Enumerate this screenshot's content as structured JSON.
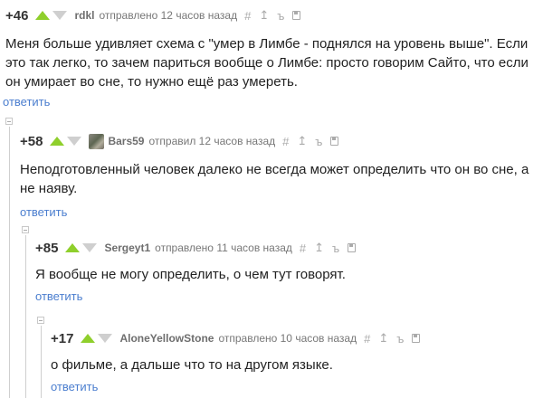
{
  "comments": [
    {
      "rating": "+46",
      "user": "rdkl",
      "meta": "отправлено 12 часов назад",
      "text": "Меня больше удивляет схема с \"умер в Лимбе - поднялся на уровень выше\". Если это так легко, то зачем париться вообще о Лимбе: просто говорим Сайто, что если он умирает во сне, то нужно ещё раз умереть.",
      "reply": "ответить"
    },
    {
      "rating": "+58",
      "user": "Bars59",
      "meta": "отправил 12 часов назад",
      "text": "Неподготовленный человек далеко не всегда может определить что он во сне, а не наяву.",
      "reply": "ответить"
    },
    {
      "rating": "+85",
      "user": "Sergeyt1",
      "meta": "отправлено 11 часов назад",
      "text": "Я вообще не могу определить, о чем тут говорят.",
      "reply": "ответить"
    },
    {
      "rating": "+17",
      "user": "AloneYellowStone",
      "meta": "отправлено 10 часов назад",
      "text": "о фильме, а дальше что то на другом языке.",
      "reply": "ответить"
    }
  ],
  "icons": [
    "hash-icon",
    "pin-icon",
    "tree-icon",
    "save-icon"
  ],
  "colors": {
    "upvote": "#8fcf2c",
    "link": "#4b7ecf"
  }
}
